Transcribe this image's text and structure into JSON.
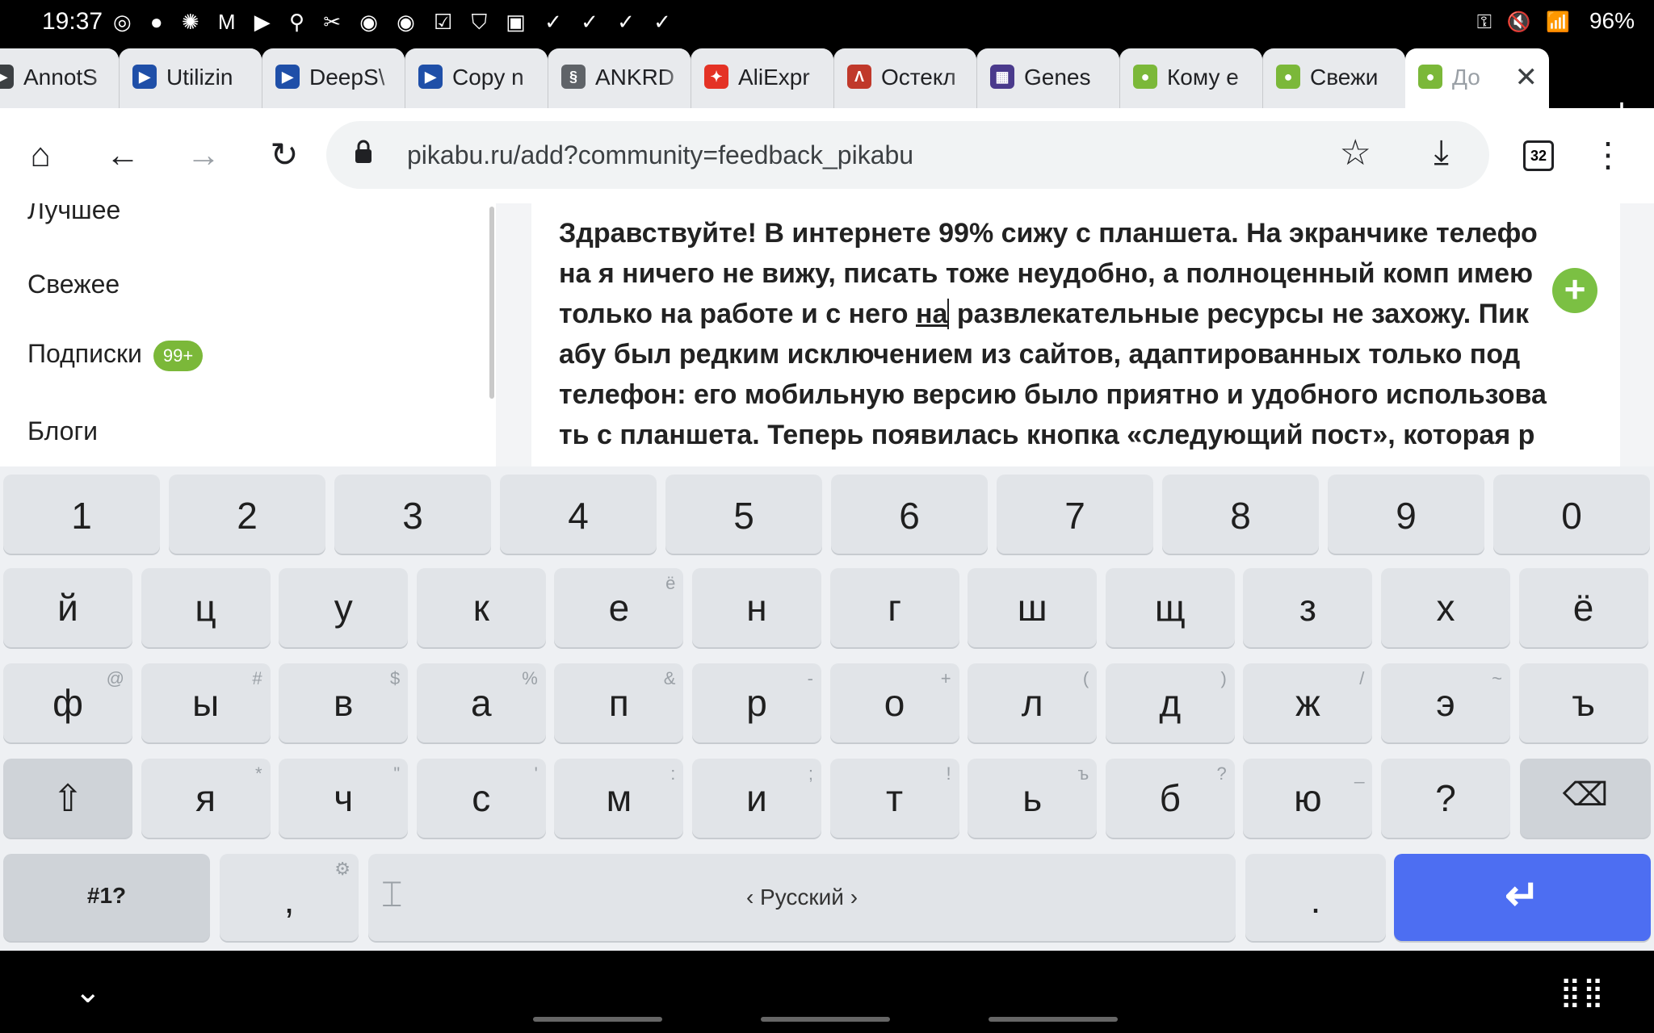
{
  "status_bar": {
    "time": "19:37",
    "notification_icons": "◎ ● ✺ M ▶ ⚲ ✂ ◉ ◉ ☑ ⛉ ▣ ✓ ✓ ✓ ✓",
    "right_icons": "⚿ 🔇 📶",
    "battery": "96%"
  },
  "tabs": [
    {
      "label": "AnnotS",
      "favicon_color": "#3c4043",
      "favicon": "▶"
    },
    {
      "label": "Utilizin",
      "favicon_color": "#1f4fa8",
      "favicon": "▶"
    },
    {
      "label": "DeepS\\",
      "favicon_color": "#1f4fa8",
      "favicon": "▶"
    },
    {
      "label": "Copy n",
      "favicon_color": "#1f4fa8",
      "favicon": "▶"
    },
    {
      "label": "ANKRD",
      "favicon_color": "#5f6368",
      "favicon": "§"
    },
    {
      "label": "AliExpr",
      "favicon_color": "#e43225",
      "favicon": "✦"
    },
    {
      "label": "Остекл",
      "favicon_color": "#c0392b",
      "favicon": "Λ"
    },
    {
      "label": "Genes",
      "favicon_color": "#4a3a8c",
      "favicon": "▦"
    },
    {
      "label": "Кому е",
      "favicon_color": "#7bb839",
      "favicon": "●"
    },
    {
      "label": "Свежи",
      "favicon_color": "#7bb839",
      "favicon": "●"
    },
    {
      "label": "До",
      "favicon_color": "#7bb839",
      "favicon": "●",
      "active": true
    }
  ],
  "toolbar": {
    "url": "pikabu.ru/add?community=feedback_pikabu",
    "tab_count": "32"
  },
  "sidebar": {
    "items": [
      {
        "label": "Лучшее"
      },
      {
        "label": "Свежее"
      },
      {
        "label": "Подписки",
        "badge": "99+"
      },
      {
        "label": "Блоги"
      }
    ]
  },
  "editor": {
    "lines": [
      "Здравствуйте! В интернете 99% сижу с планшета. На экранчике телефо",
      "на я ничего не вижу, писать тоже неудобно, а полноценный комп имею",
      "только на работе и с него ",
      "абу был редким исключением из сайтов, адаптированных только под",
      "телефон: его мобильную версию было приятно и удобного использова",
      "ть с планшета. Теперь появилась кнопка «следующий пост», которая р"
    ],
    "cursor_word": "на",
    "line3_rest": "развлекательные ресурсы не захожу.  Пик"
  },
  "keyboard": {
    "numbers": [
      "1",
      "2",
      "3",
      "4",
      "5",
      "6",
      "7",
      "8",
      "9",
      "0"
    ],
    "row1": [
      {
        "k": "й",
        "s": ""
      },
      {
        "k": "ц",
        "s": ""
      },
      {
        "k": "у",
        "s": ""
      },
      {
        "k": "к",
        "s": ""
      },
      {
        "k": "е",
        "s": "ё"
      },
      {
        "k": "н",
        "s": ""
      },
      {
        "k": "г",
        "s": ""
      },
      {
        "k": "ш",
        "s": ""
      },
      {
        "k": "щ",
        "s": ""
      },
      {
        "k": "з",
        "s": ""
      },
      {
        "k": "х",
        "s": ""
      },
      {
        "k": "ё",
        "s": ""
      }
    ],
    "row2": [
      {
        "k": "ф",
        "s": "@"
      },
      {
        "k": "ы",
        "s": "#"
      },
      {
        "k": "в",
        "s": "$"
      },
      {
        "k": "а",
        "s": "%"
      },
      {
        "k": "п",
        "s": "&"
      },
      {
        "k": "р",
        "s": "-"
      },
      {
        "k": "о",
        "s": "+"
      },
      {
        "k": "л",
        "s": "("
      },
      {
        "k": "д",
        "s": ")"
      },
      {
        "k": "ж",
        "s": "/"
      },
      {
        "k": "э",
        "s": "~"
      },
      {
        "k": "ъ",
        "s": ""
      }
    ],
    "row3": [
      {
        "k": "я",
        "s": "*"
      },
      {
        "k": "ч",
        "s": "\""
      },
      {
        "k": "с",
        "s": "'"
      },
      {
        "k": "м",
        "s": ":"
      },
      {
        "k": "и",
        "s": ";"
      },
      {
        "k": "т",
        "s": "!"
      },
      {
        "k": "ь",
        "s": "ъ"
      },
      {
        "k": "б",
        "s": "?"
      },
      {
        "k": "ю",
        "s": "_"
      },
      {
        "k": "?",
        "s": ""
      }
    ],
    "symbols_label": "#1?",
    "comma": ",",
    "space_label": "‹ Русский ›",
    "period": ".",
    "shift_icon": "⇧",
    "backspace_icon": "⌫",
    "enter_icon": "↵"
  }
}
